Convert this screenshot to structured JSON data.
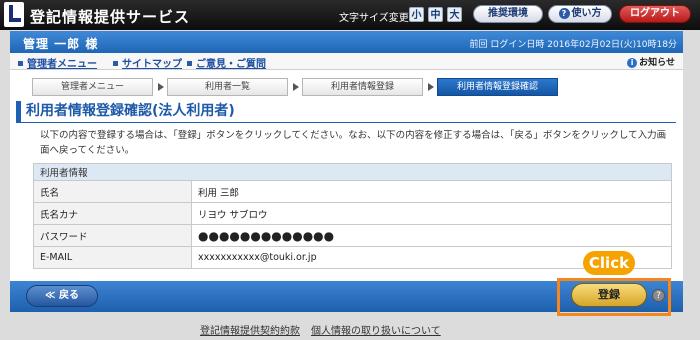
{
  "header": {
    "app_title": "登記情報提供サービス",
    "font_size_label": "文字サイズ変更",
    "font_sizes": [
      "小",
      "中",
      "大"
    ],
    "recommended_env": "推奨環境",
    "usage": "使い方",
    "logout": "ログアウト",
    "help_glyph": "?"
  },
  "userbar": {
    "user_name": "管理 一郎 様",
    "last_login": "前回 ログイン日時 2016年02月02日(火)10時18分"
  },
  "nav_links": {
    "admin_menu": "管理者メニュー",
    "sitemap": "サイトマップ",
    "feedback": "ご意見・ご質問",
    "notice": "お知らせ",
    "info_glyph": "i"
  },
  "steps": [
    "管理者メニュー",
    "利用者一覧",
    "利用者情報登録",
    "利用者情報登録確認"
  ],
  "page": {
    "title": "利用者情報登録確認(法人利用者)",
    "description": "以下の内容で登録する場合は、「登録」ボタンをクリックしてください。なお、以下の内容を修正する場合は、「戻る」ボタンをクリックして入力画面へ戻ってください。"
  },
  "table": {
    "header": "利用者情報",
    "rows": [
      {
        "label": "氏名",
        "value": "利用 三郎"
      },
      {
        "label": "氏名カナ",
        "value": "リヨウ サブロウ"
      },
      {
        "label": "パスワード",
        "value": "●●●●●●●●●●●●●"
      },
      {
        "label": "E-MAIL",
        "value": "xxxxxxxxxxx@touki.or.jp"
      }
    ]
  },
  "actions": {
    "back": "≪ 戻る",
    "register": "登録",
    "help_glyph": "?",
    "click_callout": "Click"
  },
  "footer_links": {
    "terms": "登記情報提供契約約款",
    "privacy": "個人情報の取り扱いについて"
  },
  "colors": {
    "accent_blue": "#1f66b5",
    "callout_orange": "#f3871c",
    "register_gold": "#d7a52a",
    "logout_red": "#b81a1a"
  }
}
